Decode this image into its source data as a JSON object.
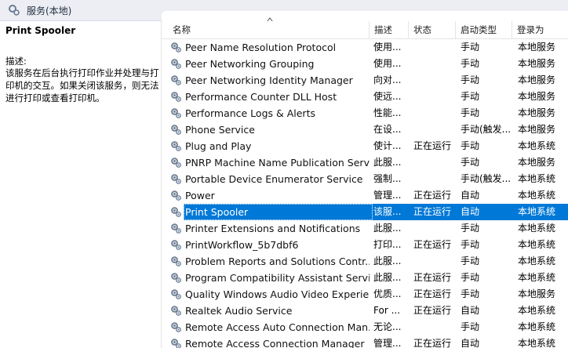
{
  "window": {
    "title": "服务(本地)"
  },
  "left_pane": {
    "service_title": "Print Spooler",
    "desc_label": "描述:",
    "desc_text": "该服务在后台执行打印作业并处理与打印机的交互。如果关闭该服务，则无法进行打印或查看打印机。"
  },
  "columns": [
    {
      "label": "名称"
    },
    {
      "label": "描述"
    },
    {
      "label": "状态"
    },
    {
      "label": "启动类型"
    },
    {
      "label": "登录为"
    }
  ],
  "rows": [
    {
      "name": "Peer Name Resolution Protocol",
      "desc": "使用...",
      "status": "",
      "start": "手动",
      "logon": "本地服务"
    },
    {
      "name": "Peer Networking Grouping",
      "desc": "使用...",
      "status": "",
      "start": "手动",
      "logon": "本地服务"
    },
    {
      "name": "Peer Networking Identity Manager",
      "desc": "向对...",
      "status": "",
      "start": "手动",
      "logon": "本地服务"
    },
    {
      "name": "Performance Counter DLL Host",
      "desc": "使远...",
      "status": "",
      "start": "手动",
      "logon": "本地服务"
    },
    {
      "name": "Performance Logs & Alerts",
      "desc": "性能...",
      "status": "",
      "start": "手动",
      "logon": "本地服务"
    },
    {
      "name": "Phone Service",
      "desc": "在设...",
      "status": "",
      "start": "手动(触发...",
      "logon": "本地服务"
    },
    {
      "name": "Plug and Play",
      "desc": "使计...",
      "status": "正在运行",
      "start": "手动",
      "logon": "本地系统"
    },
    {
      "name": "PNRP Machine Name Publication Servi...",
      "desc": "此服...",
      "status": "",
      "start": "手动",
      "logon": "本地服务"
    },
    {
      "name": "Portable Device Enumerator Service",
      "desc": "强制...",
      "status": "",
      "start": "手动(触发...",
      "logon": "本地系统"
    },
    {
      "name": "Power",
      "desc": "管理...",
      "status": "正在运行",
      "start": "自动",
      "logon": "本地系统"
    },
    {
      "name": "Print Spooler",
      "desc": "该服...",
      "status": "正在运行",
      "start": "自动",
      "logon": "本地系统",
      "selected": true
    },
    {
      "name": "Printer Extensions and Notifications",
      "desc": "此服...",
      "status": "",
      "start": "手动",
      "logon": "本地系统"
    },
    {
      "name": "PrintWorkflow_5b7dbf6",
      "desc": "打印...",
      "status": "正在运行",
      "start": "手动",
      "logon": "本地系统"
    },
    {
      "name": "Problem Reports and Solutions Contr...",
      "desc": "此服...",
      "status": "",
      "start": "手动",
      "logon": "本地系统"
    },
    {
      "name": "Program Compatibility Assistant Service",
      "desc": "此服...",
      "status": "正在运行",
      "start": "手动",
      "logon": "本地系统"
    },
    {
      "name": "Quality Windows Audio Video Experie...",
      "desc": "优质...",
      "status": "正在运行",
      "start": "手动",
      "logon": "本地服务"
    },
    {
      "name": "Realtek Audio Service",
      "desc": "For ...",
      "status": "正在运行",
      "start": "自动",
      "logon": "本地系统"
    },
    {
      "name": "Remote Access Auto Connection Man...",
      "desc": "无论...",
      "status": "",
      "start": "手动",
      "logon": "本地系统"
    },
    {
      "name": "Remote Access Connection Manager",
      "desc": "管理...",
      "status": "正在运行",
      "start": "自动",
      "logon": "本地系统"
    }
  ],
  "colors": {
    "selection": "#0078d7",
    "titlebar": "#eceef3"
  },
  "icons": {
    "title": "services-gear-icon",
    "row": "service-gear-icon",
    "sort": "sort-ascending-icon"
  }
}
